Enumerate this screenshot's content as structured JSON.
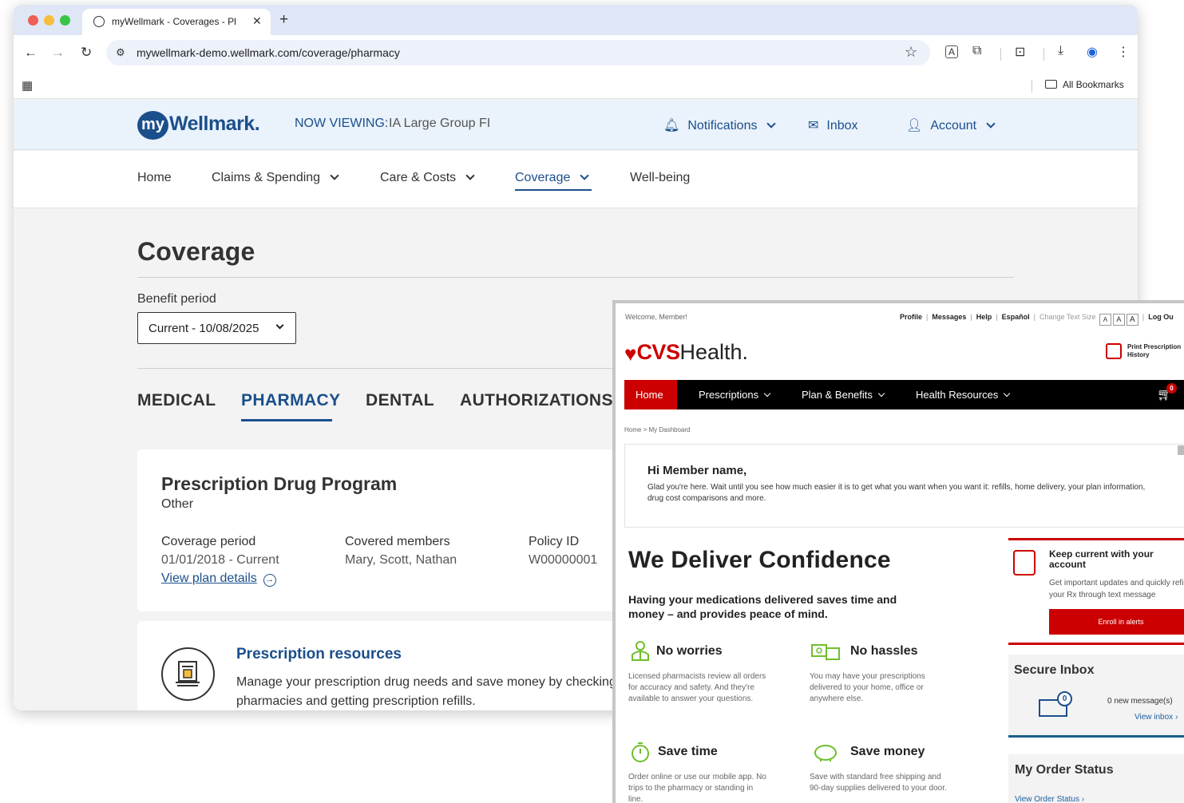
{
  "browser": {
    "tab_title": "myWellmark - Coverages - Pl",
    "url": "mywellmark-demo.wellmark.com/coverage/pharmacy",
    "bookmarks_label": "All Bookmarks",
    "colors": {
      "tabstrip": "#dfe7f6",
      "omnibox": "#edf1fa"
    }
  },
  "wellmark": {
    "logo_my": "my",
    "logo_brand": "Wellmark.",
    "now_viewing_label": "NOW VIEWING:",
    "now_viewing_value": "IA Large Group FI",
    "header": {
      "notifications": "Notifications",
      "inbox": "Inbox",
      "account": "Account"
    },
    "nav": {
      "home": "Home",
      "claims": "Claims & Spending",
      "care": "Care & Costs",
      "coverage": "Coverage",
      "wellbeing": "Well-being"
    },
    "page_title": "Coverage",
    "benefit_period_label": "Benefit period",
    "benefit_period_value": "Current - 10/08/2025",
    "tabs": [
      "MEDICAL",
      "PHARMACY",
      "DENTAL",
      "AUTHORIZATIONS"
    ],
    "program": {
      "title": "Prescription Drug Program",
      "subtitle": "Other",
      "coverage_period_label": "Coverage period",
      "coverage_period_value": "01/01/2018 - Current",
      "covered_members_label": "Covered members",
      "covered_members_value": "Mary, Scott, Nathan",
      "policy_id_label": "Policy ID",
      "policy_id_value": "W00000001",
      "view_plan": "View plan details"
    },
    "resources": {
      "title": "Prescription resources",
      "description": "Manage your prescription drug needs and save money by checking costs, finding pharmacies and getting prescription refills."
    },
    "colors": {
      "brand": "#1b4f8c",
      "header_bg": "#eaf2fb"
    }
  },
  "cvs": {
    "welcome": "Welcome, Member!",
    "util": {
      "profile": "Profile",
      "messages": "Messages",
      "help": "Help",
      "espanol": "Español",
      "text_size": "Change Text Size",
      "size_a": "A",
      "logout": "Log Ou"
    },
    "logo_cvs": "CVS",
    "logo_health": "Health.",
    "print_history": "Print Prescription History",
    "nav": {
      "home": "Home",
      "prescriptions": "Prescriptions",
      "plan": "Plan & Benefits",
      "resources": "Health Resources",
      "cart_count": "0"
    },
    "breadcrumb": "Home  >  My Dashboard",
    "greeting": "Hi Member name,",
    "greeting_text": "Glad you're here. Wait until you see how much easier it is to get what you want when you want it: refills, home delivery, your plan information, drug cost comparisons and more.",
    "headline": "We Deliver Confidence",
    "subheadline": "Having your medications delivered saves time and money – and provides peace of mind.",
    "features": [
      {
        "title": "No worries",
        "text": "Licensed pharmacists review all orders for accuracy and safety. And they're available to answer your questions."
      },
      {
        "title": "No hassles",
        "text": "You may have your prescriptions delivered to your home, office or anywhere else."
      },
      {
        "title": "Save time",
        "text": "Order online or use our mobile app. No trips to the pharmacy or standing in line."
      },
      {
        "title": "Save money",
        "text": "Save with standard free shipping and 90-day supplies delivered to your door."
      }
    ],
    "alerts": {
      "title": "Keep current with your account",
      "text": "Get important updates and quickly refill your Rx through text message",
      "button": "Enroll in alerts"
    },
    "inbox": {
      "title": "Secure Inbox",
      "badge": "0",
      "new_messages": "0 new message(s)",
      "view": "View inbox ›"
    },
    "order": {
      "title": "My Order Status",
      "link": "View Order Status ›"
    },
    "colors": {
      "red": "#cc0000",
      "nav_bg": "#000000"
    }
  }
}
